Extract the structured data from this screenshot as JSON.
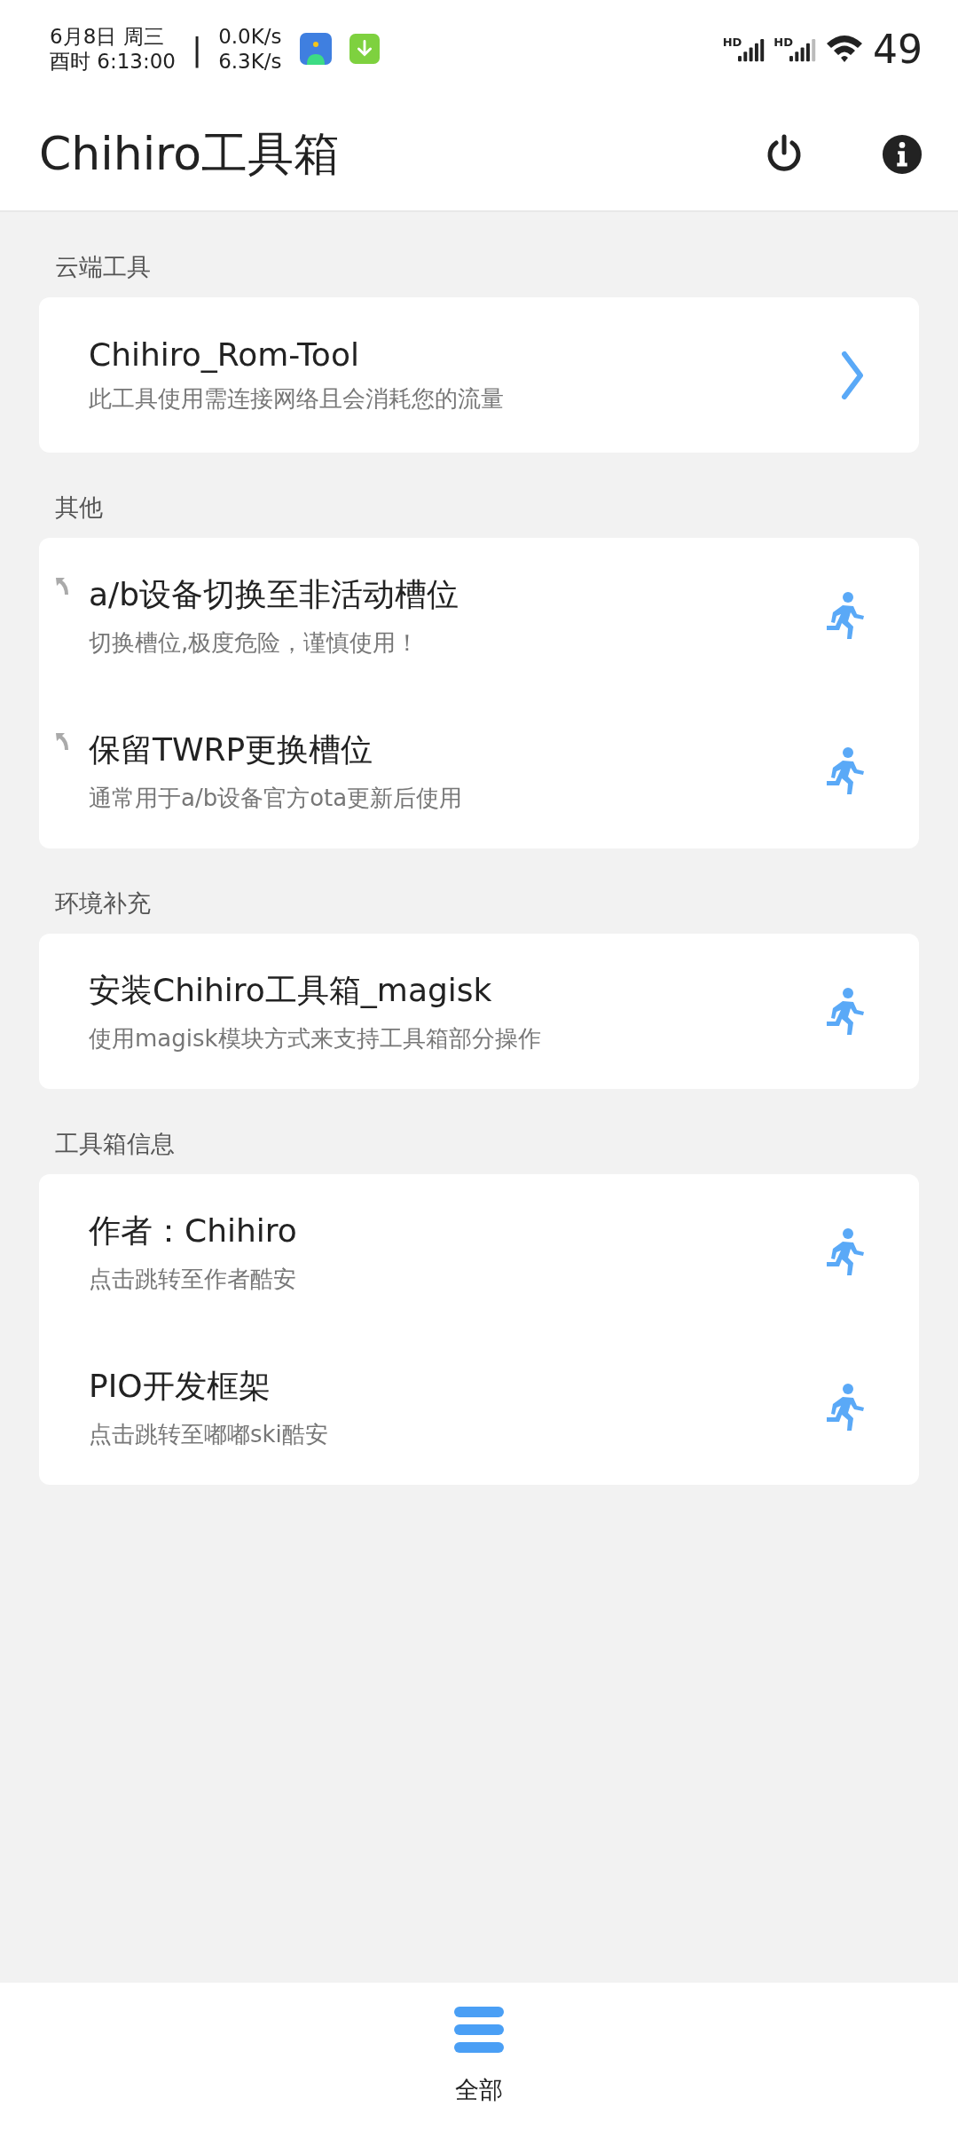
{
  "status_bar": {
    "date": "6月8日 周三",
    "time": "酉时 6:13:00",
    "separator": "|",
    "speed_up": "0.0K/s",
    "speed_down": "6.3K/s",
    "network_labels": [
      "HD",
      "HD"
    ],
    "battery": "49"
  },
  "app_bar": {
    "title": "Chihiro工具箱"
  },
  "sections": [
    {
      "header": "云端工具",
      "items": [
        {
          "kind": "arrow",
          "corner_mark": false,
          "title": "Chihiro_Rom-Tool",
          "subtitle": "此工具使用需连接网络且会消耗您的流量"
        }
      ]
    },
    {
      "header": "其他",
      "items": [
        {
          "kind": "run",
          "corner_mark": true,
          "title": "a/b设备切换至非活动槽位",
          "subtitle": "切换槽位,极度危险，谨慎使用！"
        },
        {
          "kind": "run",
          "corner_mark": true,
          "title": "保留TWRP更换槽位",
          "subtitle": "通常用于a/b设备官方ota更新后使用"
        }
      ]
    },
    {
      "header": "环境补充",
      "items": [
        {
          "kind": "run",
          "corner_mark": false,
          "title": "安装Chihiro工具箱_magisk",
          "subtitle": "使用magisk模块方式来支持工具箱部分操作"
        }
      ]
    },
    {
      "header": "工具箱信息",
      "items": [
        {
          "kind": "run",
          "corner_mark": false,
          "title": "作者：Chihiro",
          "subtitle": "点击跳转至作者酷安"
        },
        {
          "kind": "run",
          "corner_mark": false,
          "title": "PIO开发框架",
          "subtitle": "点击跳转至嘟嘟ski酷安"
        }
      ]
    }
  ],
  "bottom_nav": [
    {
      "label": "全部",
      "selected": true
    }
  ]
}
